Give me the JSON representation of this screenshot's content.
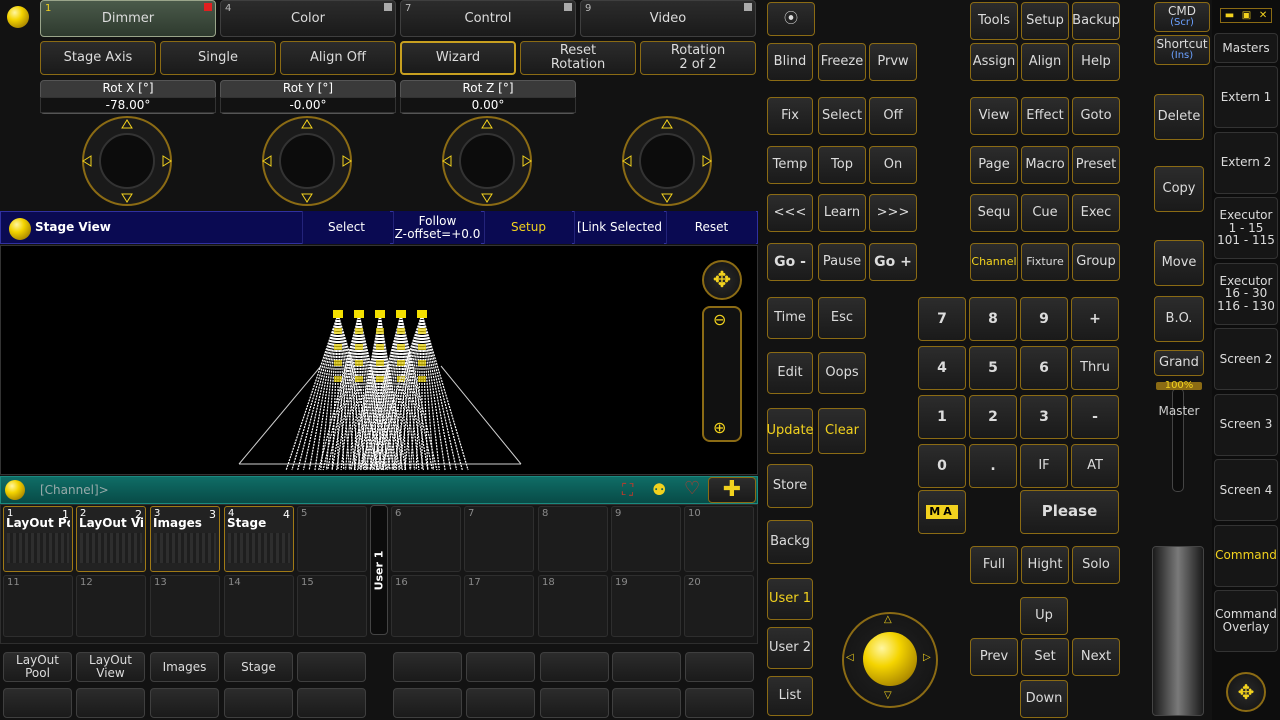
{
  "colors": {
    "accent": "#f2d21e",
    "border_gold": "#8b6b14",
    "stage_header": "#0a0a52",
    "cmd_bar": "#0b5f5a"
  },
  "preset_tabs": [
    {
      "num": "1",
      "label": "Dimmer"
    },
    {
      "num": "4",
      "label": "Color"
    },
    {
      "num": "7",
      "label": "Control"
    },
    {
      "num": "9",
      "label": "Video"
    }
  ],
  "toolbar": [
    "Stage Axis",
    "Single",
    "Align Off",
    "Wizard",
    "Reset\nRotation",
    "Rotation\n2 of 2"
  ],
  "encoders": [
    {
      "label": "Rot X [°]",
      "value": "-78.00°"
    },
    {
      "label": "Rot Y [°]",
      "value": "-0.00°"
    },
    {
      "label": "Rot Z [°]",
      "value": "0.00°"
    }
  ],
  "stage": {
    "title": "Stage View",
    "buttons": [
      "Select",
      "Follow\nZ-offset=+0.0",
      "Setup",
      "[Link Selected",
      "Reset"
    ]
  },
  "cmd_prompt": "[Channel]>",
  "pool": {
    "filled": [
      {
        "n": "1",
        "name": "LayOut Po",
        "r": "1"
      },
      {
        "n": "2",
        "name": "LayOut Vi",
        "r": "2"
      },
      {
        "n": "3",
        "name": "Images",
        "r": "3"
      },
      {
        "n": "4",
        "name": "Stage",
        "r": "4"
      }
    ],
    "row1_empty": [
      "5",
      "6",
      "7",
      "8",
      "9",
      "10"
    ],
    "row2": [
      "11",
      "12",
      "13",
      "14",
      "15",
      "16",
      "17",
      "18",
      "19",
      "20"
    ],
    "user_tab": "User 1"
  },
  "bottom_views": [
    "LayOut\nPool",
    "LayOut\nView",
    "Images",
    "Stage"
  ],
  "keys": {
    "blind": "Blind",
    "freeze": "Freeze",
    "prvw": "Prvw",
    "fix": "Fix",
    "select": "Select",
    "off": "Off",
    "temp": "Temp",
    "top": "Top",
    "on": "On",
    "prevpage": "<<<",
    "learn": "Learn",
    "nextpage": ">>>",
    "gominus": "Go -",
    "pause": "Pause",
    "goplus": "Go +",
    "time": "Time",
    "esc": "Esc",
    "edit": "Edit",
    "oops": "Oops",
    "update": "Update",
    "clear": "Clear",
    "store": "Store",
    "backg": "Backg",
    "user1": "User 1",
    "user2": "User 2",
    "list": "List",
    "tools": "Tools",
    "setup": "Setup",
    "backup": "Backup",
    "assign": "Assign",
    "align": "Align",
    "help": "Help",
    "view": "View",
    "effect": "Effect",
    "goto": "Goto",
    "page": "Page",
    "macro": "Macro",
    "preset": "Preset",
    "sequ": "Sequ",
    "cue": "Cue",
    "exec": "Exec",
    "channel": "Channel",
    "fixture": "Fixture",
    "group": "Group",
    "k7": "7",
    "k8": "8",
    "k9": "9",
    "plus": "+",
    "k4": "4",
    "k5": "5",
    "k6": "6",
    "thru": "Thru",
    "k1": "1",
    "k2": "2",
    "k3": "3",
    "minus": "-",
    "k0": "0",
    "dot": ".",
    "if": "IF",
    "at": "AT",
    "please": "Please",
    "full": "Full",
    "hight": "Hight",
    "solo": "Solo",
    "up": "Up",
    "prev": "Prev",
    "set": "Set",
    "next": "Next",
    "down": "Down",
    "ma": "MA",
    "cmd": "CMD",
    "cmd_sub": "(Scr)",
    "shortcut": "Shortcut",
    "shortcut_sub": "(Ins)",
    "delete": "Delete",
    "copy": "Copy",
    "move": "Move",
    "bo": "B.O.",
    "grand": "Grand",
    "grand_pct": "100%",
    "master": "Master"
  },
  "side": [
    "Masters",
    "Extern 1",
    "Extern 2",
    "Executor\n1 - 15\n101 - 115",
    "Executor\n16 - 30\n116 - 130",
    "Screen 2",
    "Screen 3",
    "Screen 4",
    "Command",
    "Command\nOverlay"
  ]
}
